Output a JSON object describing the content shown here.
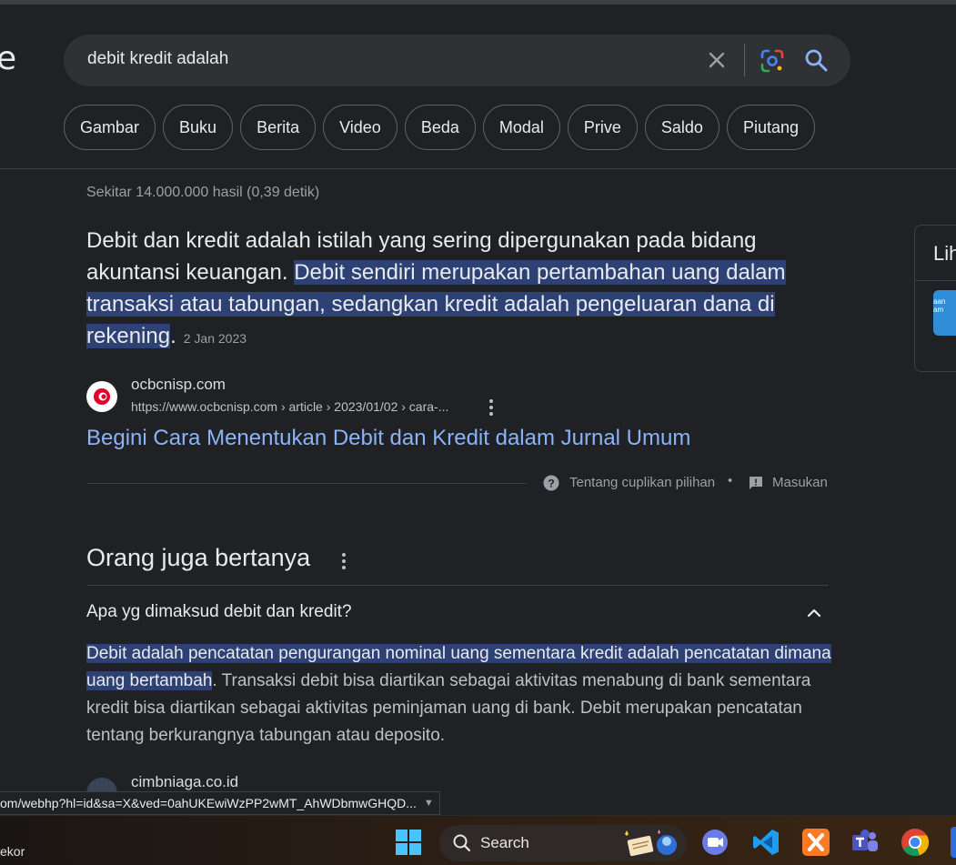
{
  "logo_fragment": "e",
  "search": {
    "query": "debit kredit adalah"
  },
  "chips": [
    "Gambar",
    "Buku",
    "Berita",
    "Video",
    "Beda",
    "Modal",
    "Prive",
    "Saldo",
    "Piutang"
  ],
  "result_stats": "Sekitar 14.000.000 hasil (0,39 detik)",
  "featured_snippet": {
    "text_plain": "Debit dan kredit adalah istilah yang sering dipergunakan pada bidang akuntansi keuangan. ",
    "text_highlight": "Debit sendiri merupakan pertambahan uang dalam transaksi atau tabungan, sedangkan kredit adalah pengeluaran dana di rekening",
    "text_end": ".",
    "date": "2 Jan 2023",
    "source_site": "ocbcnisp.com",
    "source_url": "https://www.ocbcnisp.com › article › 2023/01/02 › cara-...",
    "title": "Begini Cara Menentukan Debit dan Kredit dalam Jurnal Umum",
    "about_label": "Tentang cuplikan pilihan",
    "separator": "•",
    "feedback_label": "Masukan"
  },
  "people_also_ask": {
    "title": "Orang juga bertanya",
    "question": "Apa yg dimaksud debit dan kredit?",
    "answer_highlight": "Debit adalah pencatatan pengurangan nominal uang sementara kredit adalah pencatatan dimana uang bertambah",
    "answer_rest": ". Transaksi debit bisa diartikan sebagai aktivitas menabung di bank sementara kredit bisa diartikan sebagai aktivitas peminjaman uang di bank. Debit merupakan pencatatan tentang berkurangnya tabungan atau deposito.",
    "next_source_site": "cimbniaga.co.id"
  },
  "side_panel": {
    "label": "Lih",
    "thumb_text": "aan\nam"
  },
  "status_bar_url": "om/webhp?hl=id&sa=X&ved=0ahUKEwiWzPP2wMT_AhWDbmwGHQD...",
  "taskbar": {
    "weather_text": "ekor",
    "search_label": "Search",
    "apps": [
      "start-icon",
      "zoom-icon",
      "vscode-icon",
      "xampp-icon",
      "teams-icon",
      "chrome-icon"
    ]
  },
  "colors": {
    "background": "#202124",
    "link": "#8ab4f8",
    "highlight": "#2d4175",
    "muted": "#9aa0a6"
  }
}
